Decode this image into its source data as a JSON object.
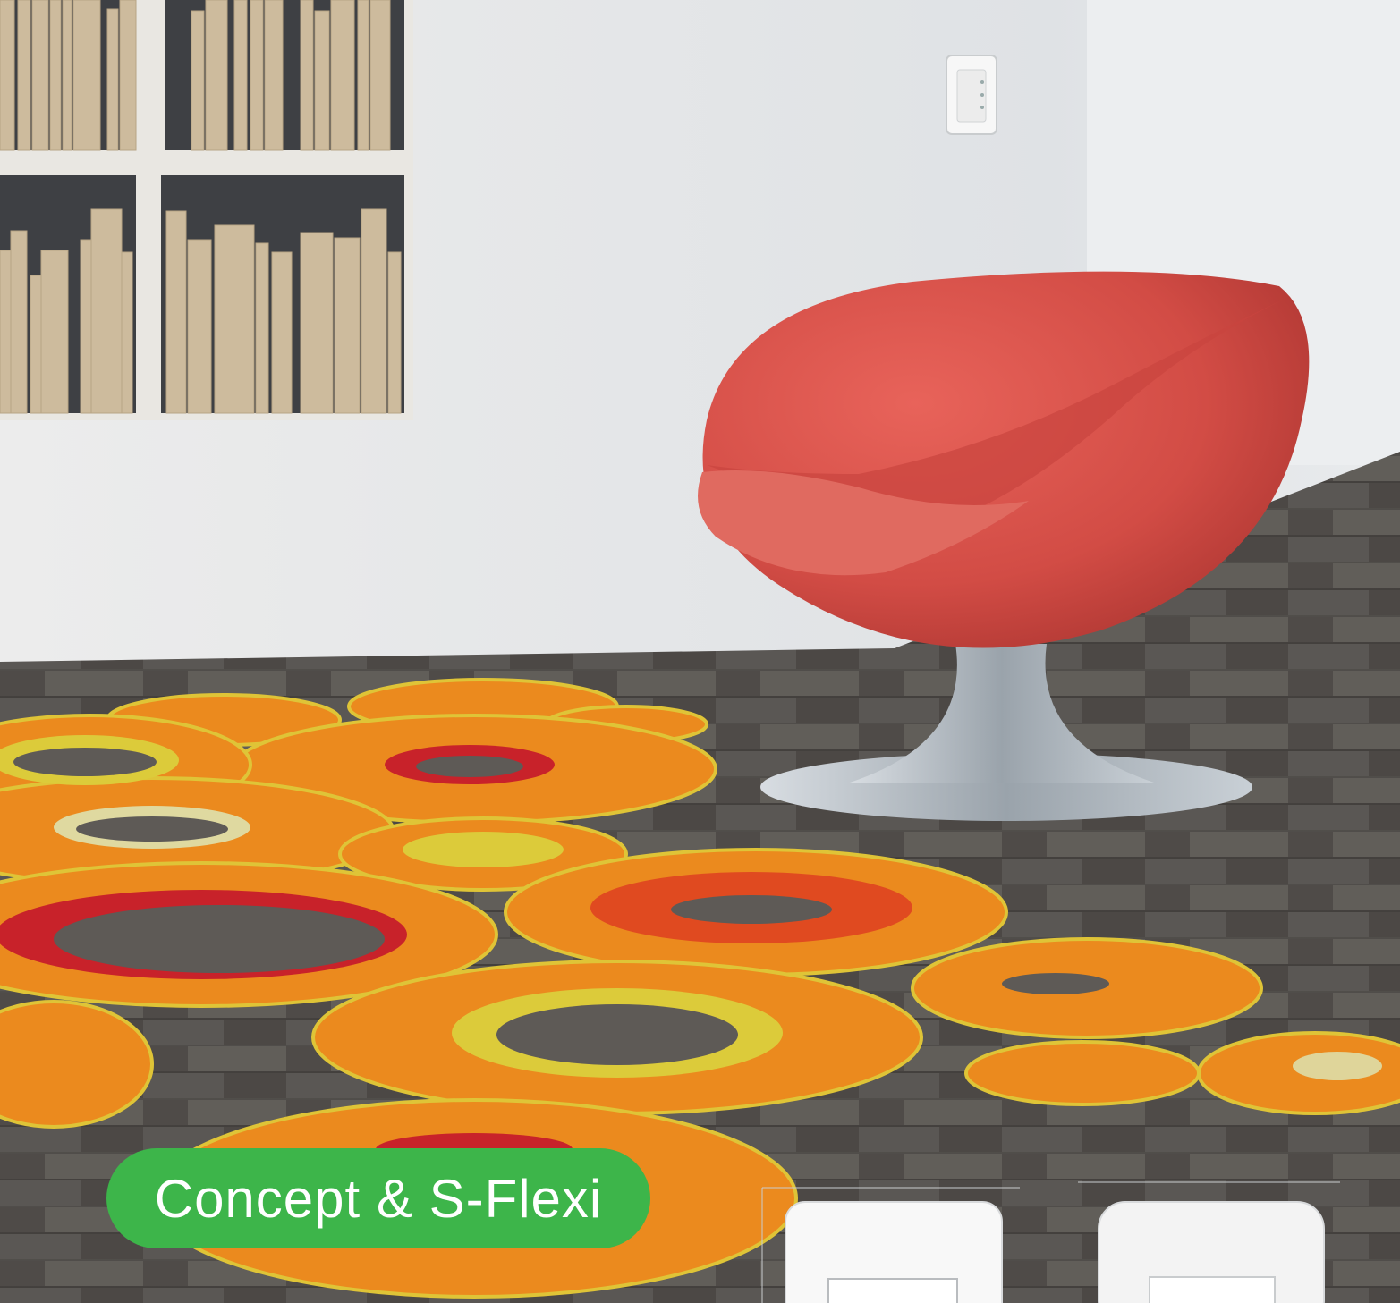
{
  "banner": {
    "label": "Concept & S-Flexi"
  },
  "colors": {
    "accent_green": "#3db54a",
    "wall": "#e6e8ea",
    "floor": "#5e5a56",
    "chair_red": "#d9524a",
    "rug_orange": "#eb8a1e",
    "rug_red": "#c8222a",
    "rug_yellow": "#dccb3a"
  },
  "icons": {
    "bookshelf": "bookshelf-image",
    "chair": "egg-chair-image",
    "rug": "circle-rug-image",
    "wall_switch": "wall-switch-image",
    "switch_panels": "switch-plate-image"
  }
}
